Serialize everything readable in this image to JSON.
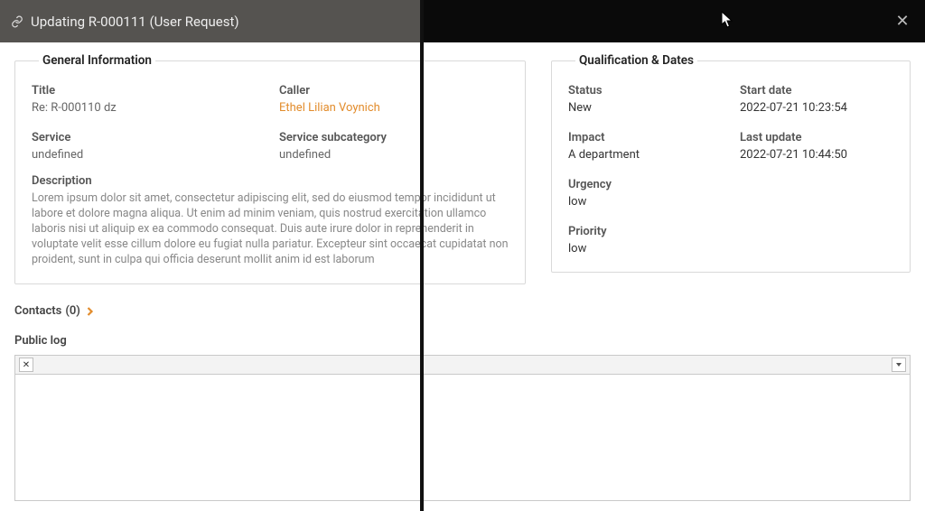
{
  "header": {
    "title": "Updating R-000111 (User Request)"
  },
  "general": {
    "legend": "General Information",
    "title_label": "Title",
    "title_value": "Re: R-000110 dz",
    "caller_label": "Caller",
    "caller_value": "Ethel Lilian Voynich",
    "service_label": "Service",
    "service_value": "undefined",
    "subcat_label": "Service subcategory",
    "subcat_value": "undefined",
    "desc_label": "Description",
    "desc_value": "Lorem ipsum dolor sit amet, consectetur adipiscing elit, sed do eiusmod tempor incididunt ut labore et dolore magna aliqua. Ut enim ad minim veniam, quis nostrud exercitation ullamco laboris nisi ut aliquip ex ea commodo consequat. Duis aute irure dolor in reprehenderit in voluptate velit esse cillum dolore eu fugiat nulla pariatur. Excepteur sint occaecat cupidatat non proident, sunt in culpa qui officia deserunt mollit anim id est laborum"
  },
  "qual": {
    "legend": "Qualification & Dates",
    "status_label": "Status",
    "status_value": "New",
    "start_label": "Start date",
    "start_value": "2022-07-21 10:23:54",
    "impact_label": "Impact",
    "impact_value": "A department",
    "lastupd_label": "Last update",
    "lastupd_value": "2022-07-21 10:44:50",
    "urgency_label": "Urgency",
    "urgency_value": "low",
    "priority_label": "Priority",
    "priority_value": "low"
  },
  "contacts": {
    "label": "Contacts",
    "count": "(0)"
  },
  "publog": {
    "title": "Public log"
  }
}
